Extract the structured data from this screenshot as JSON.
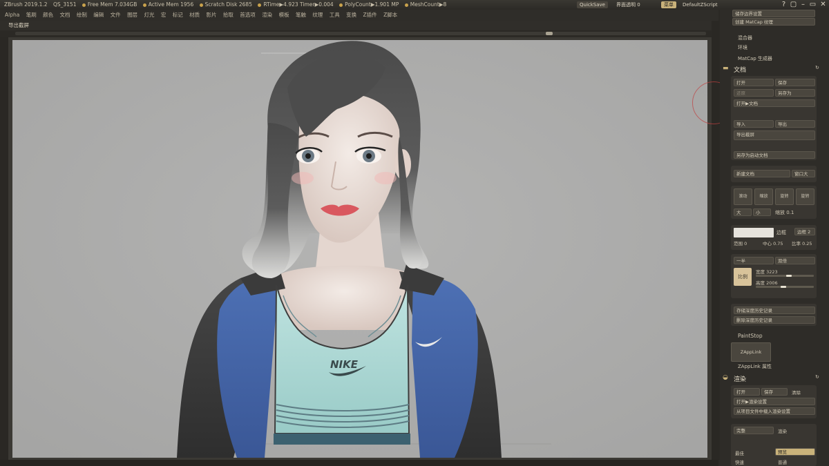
{
  "titlebar": {
    "app": "ZBrush 2019.1.2",
    "doc": "QS_3151",
    "stats": [
      {
        "label": "Free Mem 7.034GB"
      },
      {
        "label": "Active Mem 1956"
      },
      {
        "label": "Scratch Disk 2685"
      },
      {
        "label": "RTime▶4.923 Timer▶0.004"
      },
      {
        "label": "PolyCount▶1.901 MP"
      },
      {
        "label": "MeshCount▶8"
      }
    ],
    "quicksave": "QuickSave",
    "transparency": "界面透明 0",
    "menus_btn": "菜单",
    "script": "DefaultZScript"
  },
  "menubar": [
    "Alpha",
    "笔刷",
    "颜色",
    "文档",
    "绘制",
    "编辑",
    "文件",
    "图层",
    "灯光",
    "宏",
    "标记",
    "材质",
    "影片",
    "拾取",
    "首选项",
    "渲染",
    "模板",
    "笔触",
    "纹理",
    "工具",
    "变换",
    "Z插件",
    "Z脚本"
  ],
  "subbar": {
    "label": "导出截屏"
  },
  "panel": {
    "top_items": [
      "储存边界设置",
      "创建 MatCap 纹理"
    ],
    "matcap_labels": [
      "混合器",
      "环境",
      "MatCap 生成器"
    ],
    "document": {
      "title": "文档",
      "open": "打开",
      "save": "保存",
      "revert": "还原",
      "save_as": "另存为",
      "open_to_doc": "打开▶文档",
      "import": "导入",
      "export": "导出",
      "export_screen": "导出截屏",
      "save_startup": "另存为启动文档",
      "new_doc": "新建文档",
      "window_size": "窗口大",
      "nav": [
        "滚动",
        "缩放",
        "旋转",
        "旋转"
      ],
      "big": "大",
      "small": "小",
      "zoom": "缩放 0.1",
      "border": "边框",
      "border2": "边框 2",
      "range": "范围 0",
      "center": "中心 0.75",
      "ratio": "比率 0.25",
      "half": "一半",
      "double": "双倍",
      "pro": "比例",
      "width": "宽度 3223",
      "height": "高度 2006",
      "store_depth": "存储深度历史记录",
      "del_depth": "删除深度历史记录"
    },
    "paintstop": "PaintStop",
    "zapplink": "ZAppLink",
    "zapplink_props": "ZAppLink 属性",
    "render": {
      "title": "渲染",
      "open": "打开",
      "save": "保存",
      "clear": "清除",
      "open_render": "打开▶渲染设置",
      "load_render": "从项目文件中载入渲染设置",
      "full": "完整",
      "render_btn": "渲染",
      "best": "最佳",
      "preview": "预览",
      "fast": "快速",
      "normal": "普通"
    }
  },
  "artwork": {
    "logo_chest": "NIKE"
  }
}
